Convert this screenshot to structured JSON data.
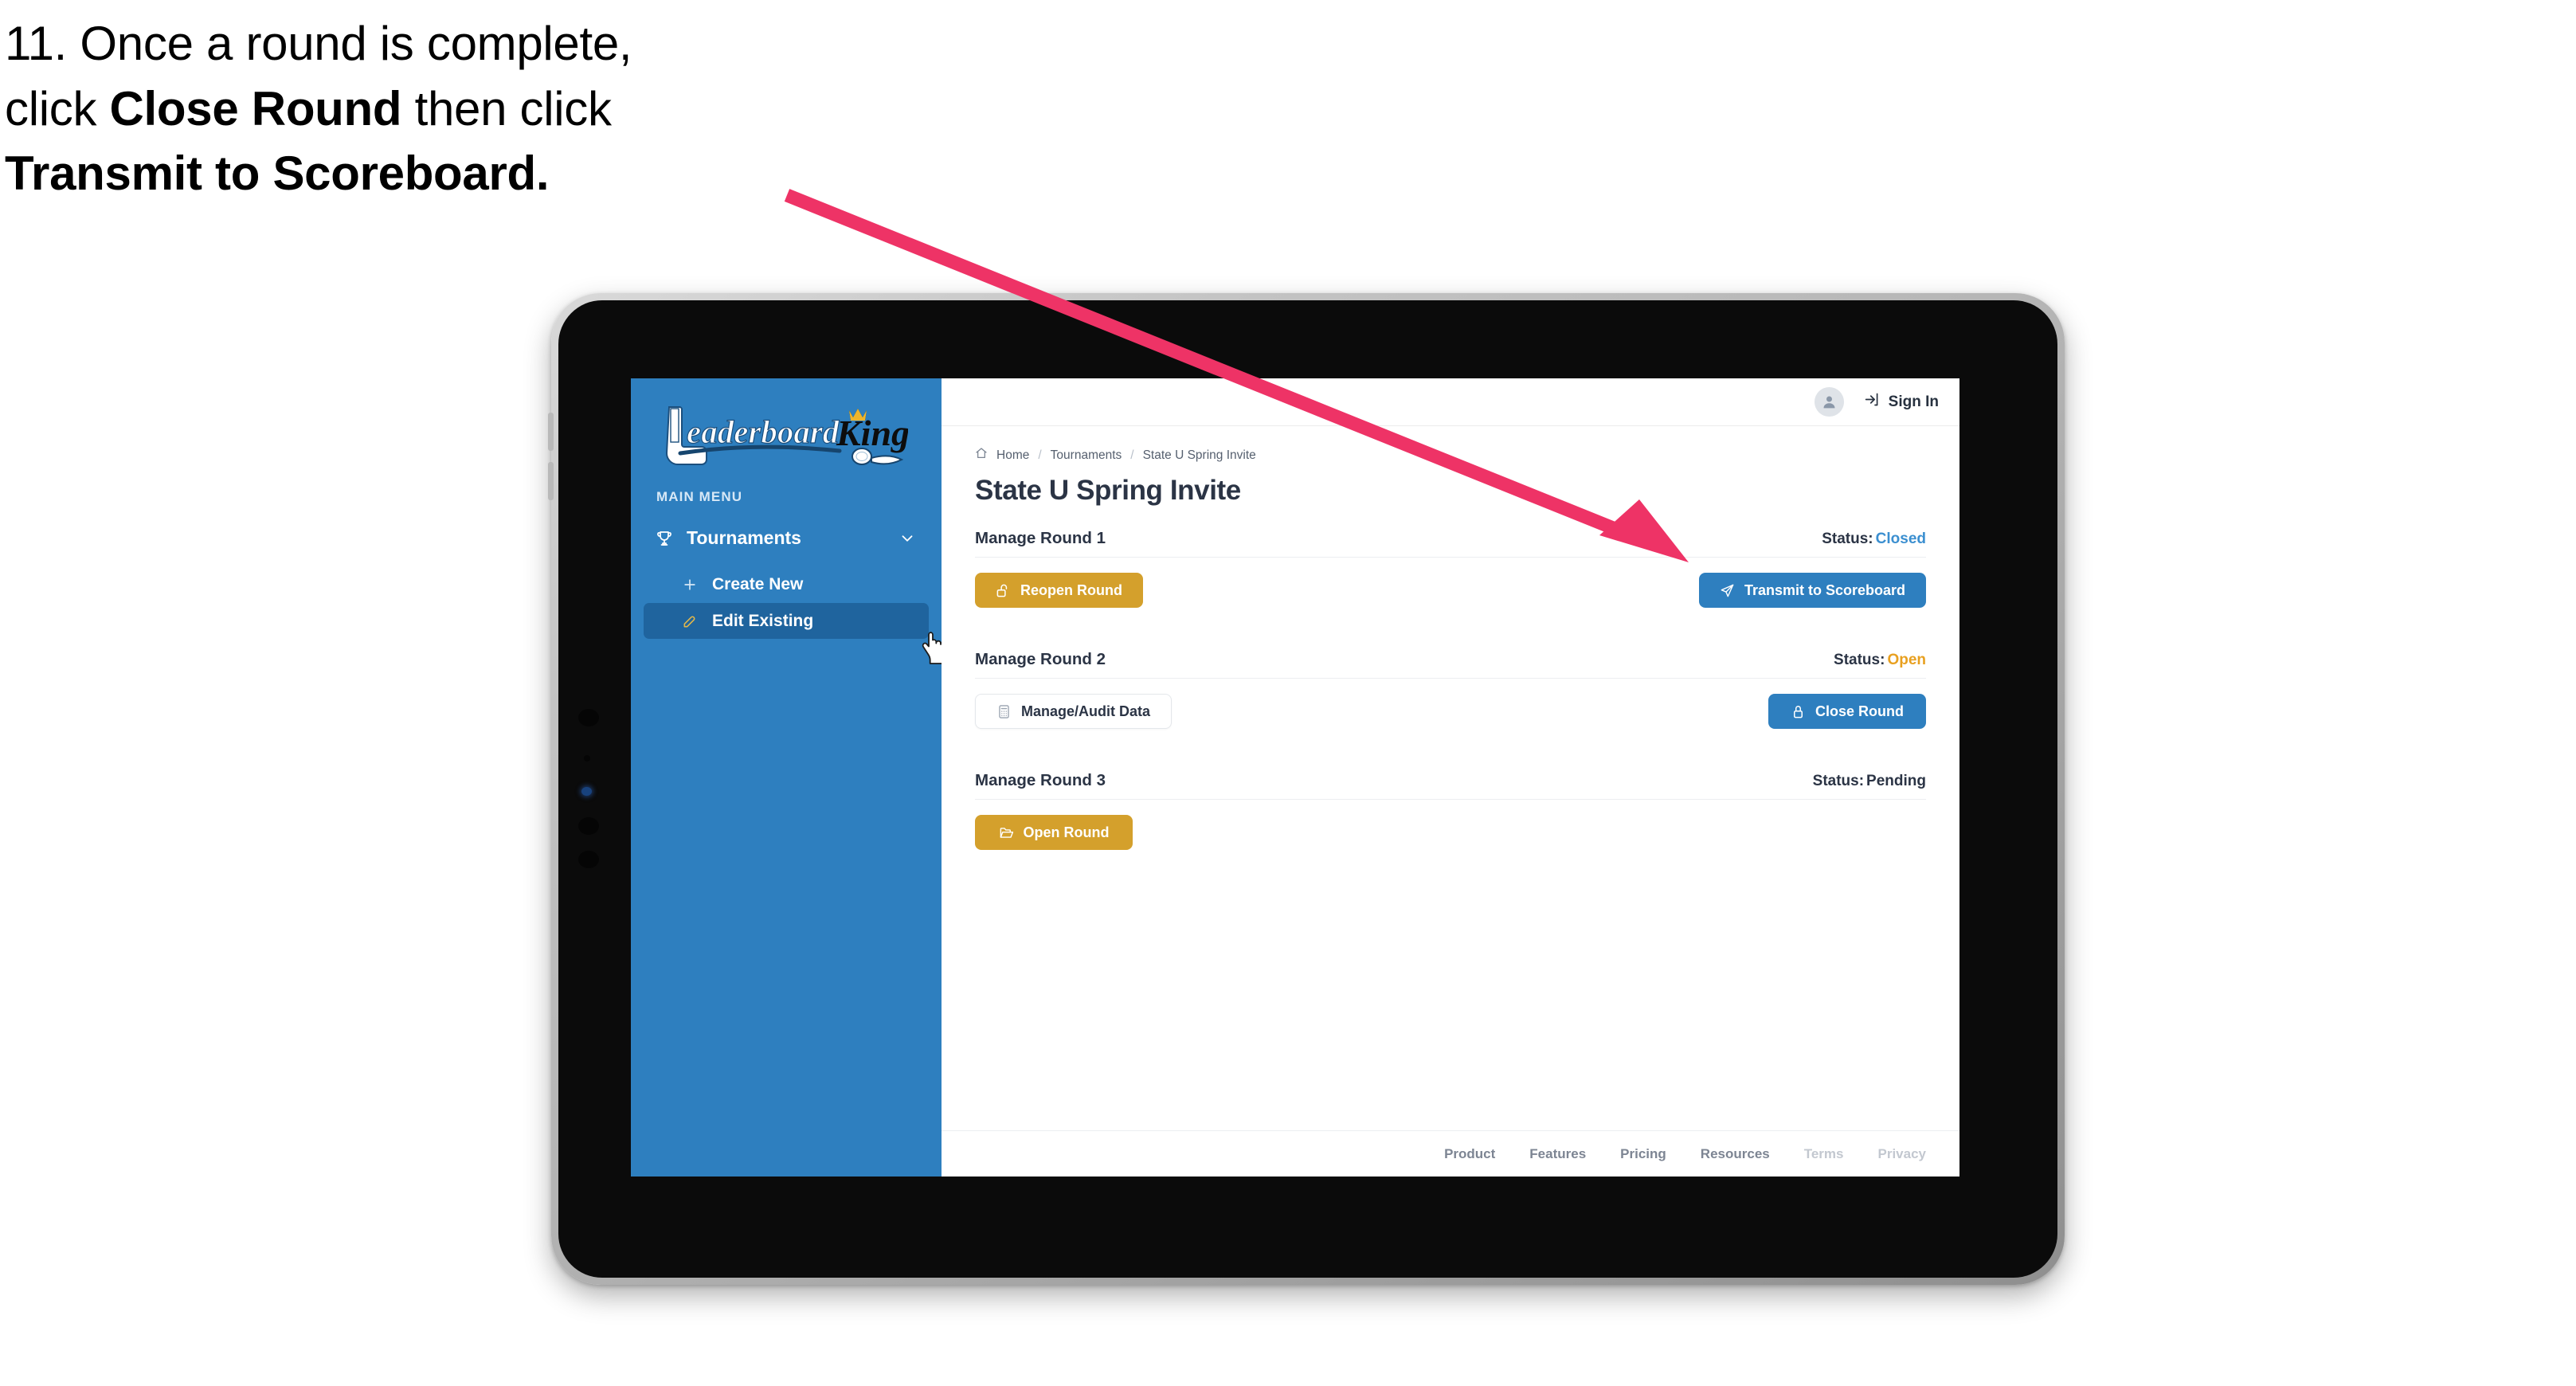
{
  "caption": {
    "line1_plain": "11. Once a round is complete,",
    "line2_pre": "click ",
    "line2_bold": "Close Round",
    "line2_post": " then click",
    "line3_bold": "Transmit to Scoreboard."
  },
  "annotation": {
    "arrow_color": "#EE3366",
    "points_to": "transmit-to-scoreboard-button"
  },
  "sidebar": {
    "logo_word1": "Leaderboard",
    "logo_word2": "King",
    "section_label": "MAIN MENU",
    "items": [
      {
        "label": "Tournaments",
        "icon": "trophy-icon",
        "expanded": true,
        "chevron": "chevron-down-icon"
      },
      {
        "label": "Create New",
        "icon": "plus-icon",
        "active": false
      },
      {
        "label": "Edit Existing",
        "icon": "edit-pencil-icon",
        "active": true
      }
    ],
    "background_color": "#2E7FBF",
    "active_item_color": "#1F649E"
  },
  "topbar": {
    "avatar_icon": "user-avatar-icon",
    "signin_icon": "sign-in-arrow-icon",
    "signin_label": "Sign In"
  },
  "breadcrumb": {
    "home_icon": "home-icon",
    "items": [
      "Home",
      "Tournaments",
      "State U Spring Invite"
    ],
    "separator": "/"
  },
  "page": {
    "title": "State U Spring Invite"
  },
  "rounds": [
    {
      "title": "Manage Round 1",
      "status_label": "Status:",
      "status_value": "Closed",
      "status_class": "status-closed",
      "left_button": {
        "label": "Reopen Round",
        "icon": "unlock-icon",
        "style": "gold"
      },
      "right_button": {
        "label": "Transmit to Scoreboard",
        "icon": "paper-plane-icon",
        "style": "blue"
      }
    },
    {
      "title": "Manage Round 2",
      "status_label": "Status:",
      "status_value": "Open",
      "status_class": "status-open",
      "left_button": {
        "label": "Manage/Audit Data",
        "icon": "calculator-icon",
        "style": "ghost"
      },
      "right_button": {
        "label": "Close Round",
        "icon": "lock-icon",
        "style": "blue"
      }
    },
    {
      "title": "Manage Round 3",
      "status_label": "Status:",
      "status_value": "Pending",
      "status_class": "status-pending",
      "left_button": {
        "label": "Open Round",
        "icon": "open-folder-icon",
        "style": "gold"
      },
      "right_button": null
    }
  ],
  "footer": {
    "links": [
      {
        "label": "Product",
        "muted": false
      },
      {
        "label": "Features",
        "muted": false
      },
      {
        "label": "Pricing",
        "muted": false
      },
      {
        "label": "Resources",
        "muted": false
      },
      {
        "label": "Terms",
        "muted": true
      },
      {
        "label": "Privacy",
        "muted": true
      }
    ]
  },
  "colors": {
    "brand_blue": "#2E7FBF",
    "gold": "#D4A02C",
    "status_closed": "#3B8FD0",
    "status_open": "#E8A020",
    "text_dark": "#2B3445",
    "annotation_pink": "#EE3366"
  },
  "cursor": {
    "type": "pointing-hand-cursor"
  }
}
